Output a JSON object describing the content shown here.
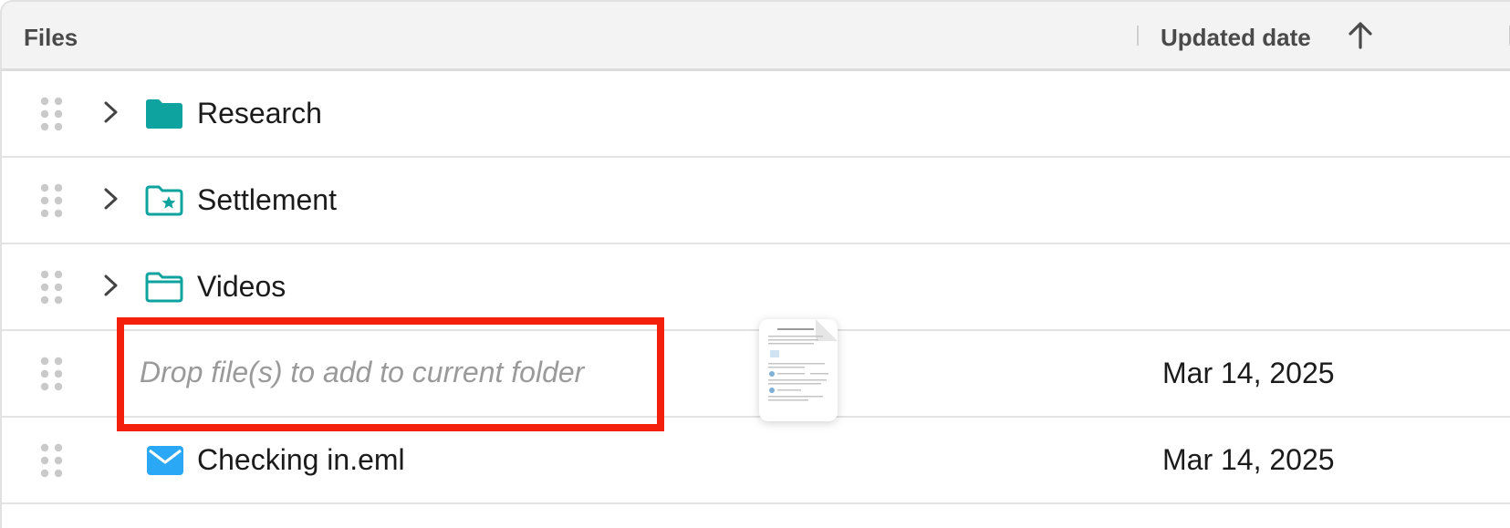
{
  "header": {
    "files_label": "Files",
    "updated_label": "Updated date",
    "sort_icon": "arrow-up-icon"
  },
  "rows": [
    {
      "name": "Research",
      "type": "folder",
      "icon": "folder-filled-icon",
      "date": ""
    },
    {
      "name": "Settlement",
      "type": "folder",
      "icon": "folder-star-icon",
      "date": ""
    },
    {
      "name": "Videos",
      "type": "folder",
      "icon": "folder-outline-icon",
      "date": ""
    },
    {
      "name": "",
      "type": "drop-target",
      "date": "Mar 14, 2025"
    },
    {
      "name": "Checking in.eml",
      "type": "email",
      "icon": "mail-icon",
      "date": "Mar 14, 2025"
    }
  ],
  "drop_zone": {
    "hint": "Drop file(s) to add to current folder"
  },
  "colors": {
    "accent": "#0fa3a0",
    "highlight": "#f3200d",
    "mail": "#2aa7f5"
  }
}
